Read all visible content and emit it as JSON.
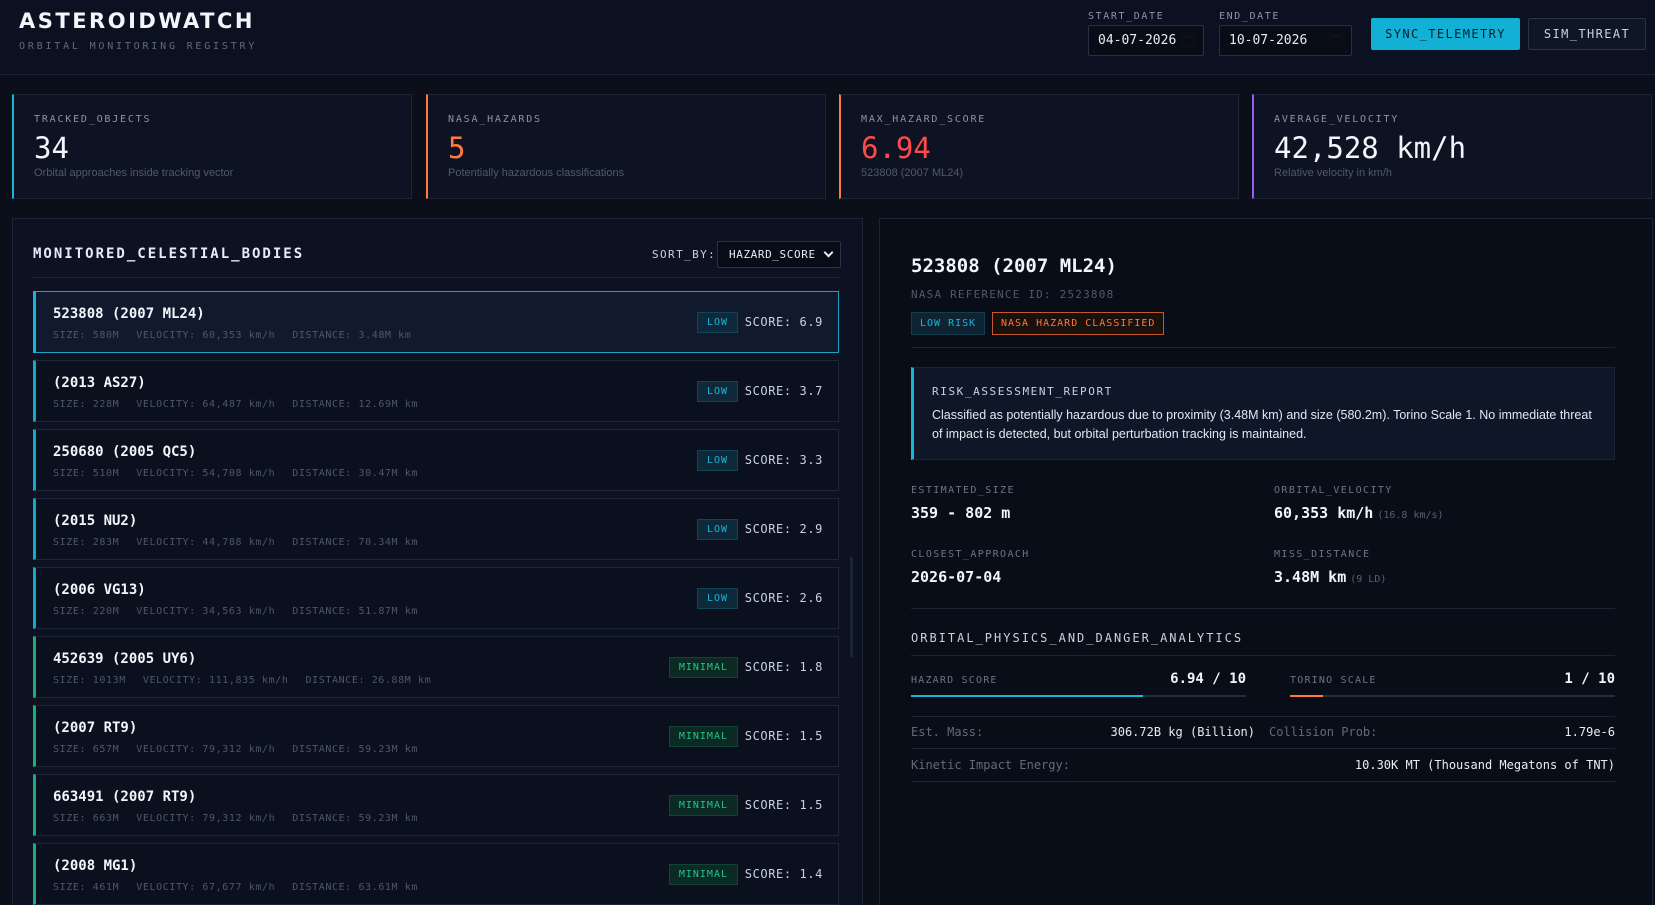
{
  "header": {
    "title": "ASTEROIDWATCH",
    "subtitle": "ORBITAL MONITORING REGISTRY",
    "start_date_label": "START_DATE",
    "start_date_value": "04-07-2026",
    "end_date_label": "END_DATE",
    "end_date_value": "10-07-2026",
    "sync_label": "SYNC_TELEMETRY",
    "sim_label": "SIM_THREAT"
  },
  "stats": [
    {
      "label": "TRACKED_OBJECTS",
      "value": "34",
      "note": "Orbital approaches inside tracking vector",
      "color": "#19b6d9",
      "value_color": "#f2f6fb"
    },
    {
      "label": "NASA_HAZARDS",
      "value": "5",
      "note": "Potentially hazardous classifications",
      "color": "#ff7a3c",
      "value_color": "#ff7a3c"
    },
    {
      "label": "MAX_HAZARD_SCORE",
      "value": "6.94",
      "note": "523808 (2007 ML24)",
      "color": "#ff7a3c",
      "value_color": "#ff4a4a"
    },
    {
      "label": "AVERAGE_VELOCITY",
      "value": "42,528 km/h",
      "note": "Relative velocity in km/h",
      "color": "#9b5cf0",
      "value_color": "#f2f6fb"
    }
  ],
  "list": {
    "title": "MONITORED_CELESTIAL_BODIES",
    "sort_label": "SORT_BY:",
    "sort_value": "HAZARD_SCORE",
    "rows": [
      {
        "name": "523808 (2007 ML24)",
        "size": "SIZE: 580M",
        "velocity": "VELOCITY: 60,353 km/h",
        "distance": "DISTANCE: 3.48M km",
        "badge": "LOW",
        "level": "low",
        "score": "SCORE: 6.9",
        "selected": true
      },
      {
        "name": "(2013 AS27)",
        "size": "SIZE: 228M",
        "velocity": "VELOCITY: 64,487 km/h",
        "distance": "DISTANCE: 12.69M km",
        "badge": "LOW",
        "level": "low",
        "score": "SCORE: 3.7"
      },
      {
        "name": "250680 (2005 QC5)",
        "size": "SIZE: 510M",
        "velocity": "VELOCITY: 54,708 km/h",
        "distance": "DISTANCE: 30.47M km",
        "badge": "LOW",
        "level": "low",
        "score": "SCORE: 3.3"
      },
      {
        "name": "(2015 NU2)",
        "size": "SIZE: 283M",
        "velocity": "VELOCITY: 44,788 km/h",
        "distance": "DISTANCE: 70.34M km",
        "badge": "LOW",
        "level": "low",
        "score": "SCORE: 2.9"
      },
      {
        "name": "(2006 VG13)",
        "size": "SIZE: 220M",
        "velocity": "VELOCITY: 34,563 km/h",
        "distance": "DISTANCE: 51.87M km",
        "badge": "LOW",
        "level": "low",
        "score": "SCORE: 2.6"
      },
      {
        "name": "452639 (2005 UY6)",
        "size": "SIZE: 1013M",
        "velocity": "VELOCITY: 111,835 km/h",
        "distance": "DISTANCE: 26.88M km",
        "badge": "MINIMAL",
        "level": "minimal",
        "score": "SCORE: 1.8"
      },
      {
        "name": "(2007 RT9)",
        "size": "SIZE: 657M",
        "velocity": "VELOCITY: 79,312 km/h",
        "distance": "DISTANCE: 59.23M km",
        "badge": "MINIMAL",
        "level": "minimal",
        "score": "SCORE: 1.5"
      },
      {
        "name": "663491 (2007 RT9)",
        "size": "SIZE: 663M",
        "velocity": "VELOCITY: 79,312 km/h",
        "distance": "DISTANCE: 59.23M km",
        "badge": "MINIMAL",
        "level": "minimal",
        "score": "SCORE: 1.5"
      },
      {
        "name": "(2008 MG1)",
        "size": "SIZE: 461M",
        "velocity": "VELOCITY: 67,677 km/h",
        "distance": "DISTANCE: 63.61M km",
        "badge": "MINIMAL",
        "level": "minimal",
        "score": "SCORE: 1.4"
      }
    ]
  },
  "detail": {
    "name": "523808 (2007 ML24)",
    "ref": "NASA REFERENCE ID: 2523808",
    "risk_tag": "LOW RISK",
    "hazard_tag": "NASA HAZARD CLASSIFIED",
    "report_title": "RISK_ASSESSMENT_REPORT",
    "report_text": "Classified as potentially hazardous due to proximity (3.48M km) and size (580.2m). Torino Scale 1. No immediate threat of impact is detected, but orbital perturbation tracking is maintained.",
    "size_label": "ESTIMATED_SIZE",
    "size_value": "359 - 802 m",
    "velocity_label": "ORBITAL_VELOCITY",
    "velocity_value": "60,353 km/h",
    "velocity_sub": "(16.8 km/s)",
    "approach_label": "CLOSEST_APPROACH",
    "approach_value": "2026-07-04",
    "miss_label": "MISS_DISTANCE",
    "miss_value": "3.48M km",
    "miss_sub": "(9 LD)",
    "physics_title": "ORBITAL_PHYSICS_AND_DANGER_ANALYTICS",
    "hazard_score_label": "HAZARD SCORE",
    "hazard_score_value": "6.94 / 10",
    "hazard_score_fraction": 0.694,
    "torino_label": "TORINO SCALE",
    "torino_value": "1 / 10",
    "torino_fraction": 0.1,
    "mass_label": "Est. Mass:",
    "mass_value": "306.72B kg (Billion)",
    "collision_label": "Collision Prob:",
    "collision_value": "1.79e-6",
    "energy_label": "Kinetic Impact Energy:",
    "energy_value": "10.30K MT (Thousand Megatons of TNT)"
  },
  "colors": {
    "accent": "#13b0d6",
    "hazard": "#ff7a3c",
    "minimal": "#22c48a"
  }
}
